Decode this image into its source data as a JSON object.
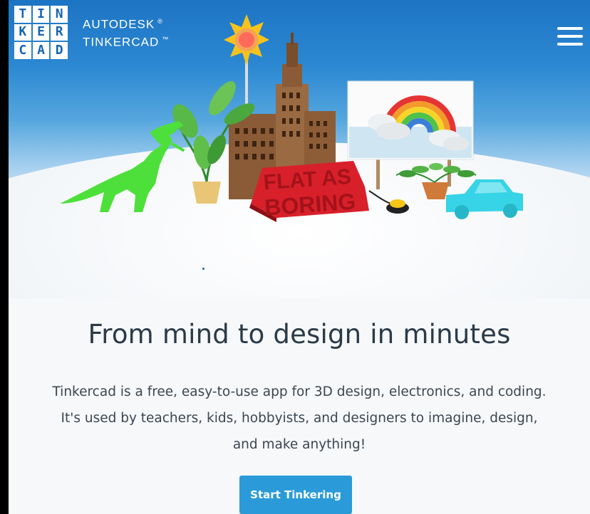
{
  "header": {
    "logo_letters": [
      "T",
      "I",
      "N",
      "K",
      "E",
      "R",
      "C",
      "A",
      "D"
    ],
    "brand_line1": "AUTODESK",
    "brand_line1_mark": "®",
    "brand_line2": "TINKERCAD",
    "brand_line2_mark": "™",
    "menu_icon": "hamburger-menu-icon"
  },
  "hero": {
    "sign_text_line1": "FLAT AS",
    "sign_text_line2": "BORING",
    "carousel_indicator": "dot"
  },
  "main": {
    "headline": "From mind to design in minutes",
    "description": "Tinkercad is a free, easy-to-use app for 3D design, electronics, and coding. It's used by teachers, kids, hobbyists, and designers to imagine, design, and make anything!",
    "cta_label": "Start Tinkering"
  },
  "colors": {
    "brand_blue": "#1665b3",
    "sky_top": "#1d74c4",
    "cta": "#2a9bd8",
    "headline_text": "#2a3a48",
    "sign_red": "#d8202a",
    "dino_green": "#4ee03a",
    "car_teal": "#37d3e6"
  }
}
